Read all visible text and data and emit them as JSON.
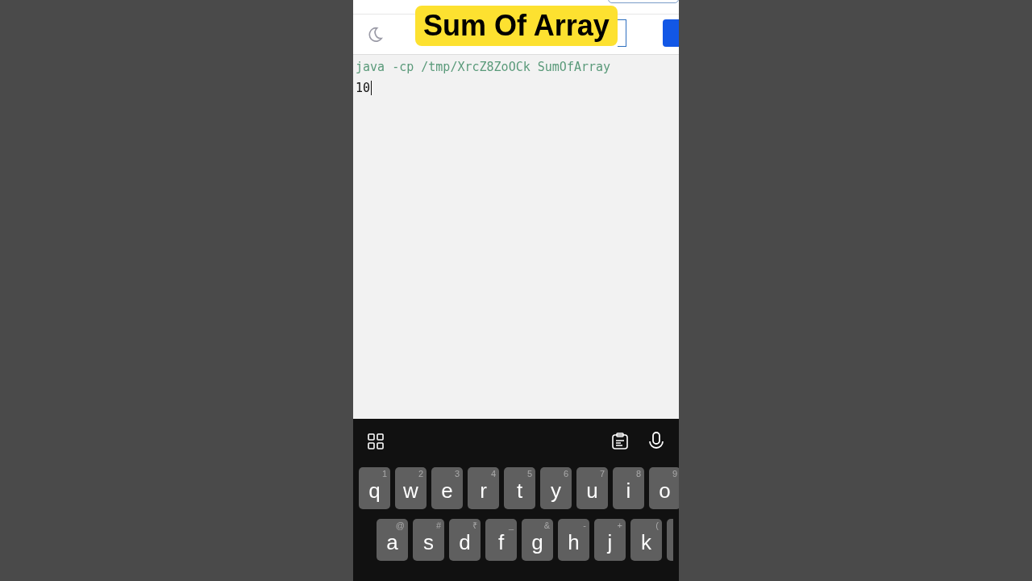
{
  "caption": "Sum Of Array",
  "terminal": {
    "lines": [
      {
        "kind": "command",
        "text": "java -cp /tmp/XrcZ8ZoOCk SumOfArray"
      },
      {
        "kind": "input",
        "text": "10"
      }
    ]
  },
  "keyboard": {
    "rows": [
      {
        "keys": [
          {
            "letter": "q",
            "hint": "1"
          },
          {
            "letter": "w",
            "hint": "2"
          },
          {
            "letter": "e",
            "hint": "3"
          },
          {
            "letter": "r",
            "hint": "4"
          },
          {
            "letter": "t",
            "hint": "5"
          },
          {
            "letter": "y",
            "hint": "6"
          },
          {
            "letter": "u",
            "hint": "7"
          },
          {
            "letter": "i",
            "hint": "8"
          },
          {
            "letter": "o",
            "hint": "9"
          }
        ]
      },
      {
        "keys": [
          {
            "letter": "a",
            "hint": "@"
          },
          {
            "letter": "s",
            "hint": "#"
          },
          {
            "letter": "d",
            "hint": "₹"
          },
          {
            "letter": "f",
            "hint": "_"
          },
          {
            "letter": "g",
            "hint": "&"
          },
          {
            "letter": "h",
            "hint": "-"
          },
          {
            "letter": "j",
            "hint": "+"
          },
          {
            "letter": "k",
            "hint": "("
          }
        ]
      }
    ]
  }
}
